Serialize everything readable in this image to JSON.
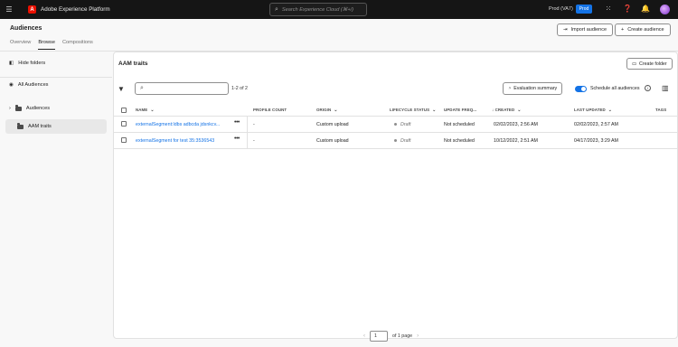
{
  "topbar": {
    "app_title": "Adobe Experience Platform",
    "search_placeholder": "Search Experience Cloud (⌘+/)",
    "org": "Prod (VA7)",
    "sandbox_badge": "Prod"
  },
  "header": {
    "title": "Audiences",
    "tabs": [
      {
        "label": "Overview",
        "active": false
      },
      {
        "label": "Browse",
        "active": true
      },
      {
        "label": "Compositions",
        "active": false
      }
    ],
    "import_label": "Import audience",
    "create_label": "Create audience"
  },
  "sidebar": {
    "hide_folders": "Hide folders",
    "all_audiences": "All Audiences",
    "audiences": "Audiences",
    "aam_traits": "AAM traits"
  },
  "main": {
    "title": "AAM traits",
    "create_folder": "Create folder",
    "count": "1-2 of 2",
    "evaluation_summary": "Evaluation summary",
    "schedule_all": "Schedule all audiences",
    "columns": [
      "NAME",
      "PROFILE COUNT",
      "ORIGIN",
      "LIFECYCLE STATUS",
      "UPDATE FREQ...",
      "CREATED",
      "LAST UPDATED",
      "TAGS"
    ],
    "rows": [
      {
        "name": "externalSegment:ldbs adbcda jdsnkcv...",
        "profile_count": "-",
        "origin": "Custom upload",
        "status": "Draft",
        "frequency": "Not scheduled",
        "created": "02/02/2023, 2:56 AM",
        "updated": "02/02/2023, 2:57 AM"
      },
      {
        "name": "externalSegment for test 35:3536543",
        "profile_count": "-",
        "origin": "Custom upload",
        "status": "Draft",
        "frequency": "Not scheduled",
        "created": "10/12/2022, 2:51 AM",
        "updated": "04/17/2023, 3:29 AM"
      }
    ]
  },
  "pagination": {
    "page": "1",
    "of_pages": "of 1 page"
  },
  "colors": {
    "accent": "#1473e6",
    "brand": "#eb1000"
  }
}
